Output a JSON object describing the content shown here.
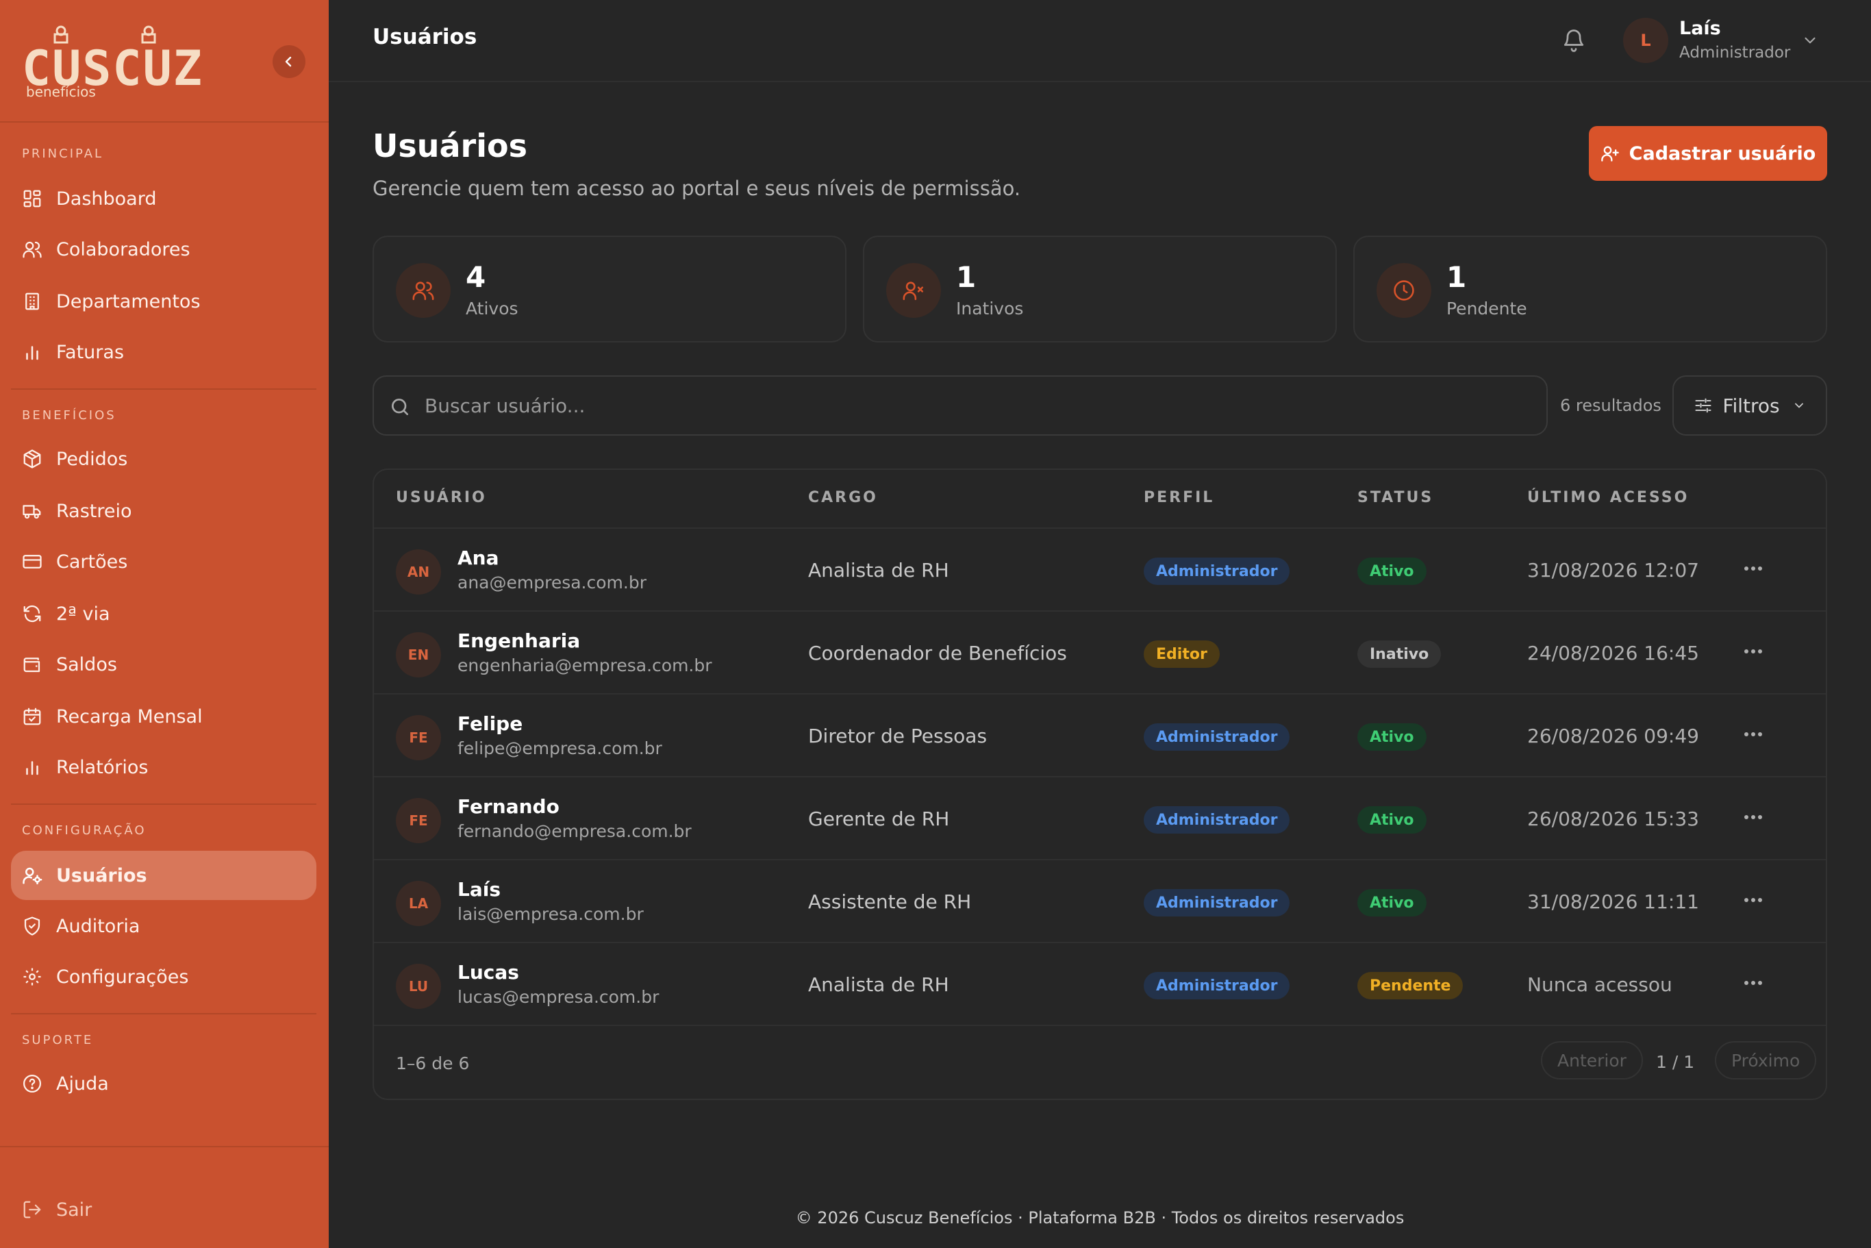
{
  "brand": {
    "name": "CUSCUZ",
    "sub": "benefícios",
    "color": "#c9512f",
    "accent": "#d9532a"
  },
  "sidebar": {
    "sections": [
      {
        "title": "PRINCIPAL"
      },
      {
        "title": "BENEFÍCIOS"
      },
      {
        "title": "CONFIGURAÇÃO"
      },
      {
        "title": "SUPORTE"
      }
    ],
    "items": [
      {
        "label": "Dashboard",
        "icon": "dashboard-icon"
      },
      {
        "label": "Colaboradores",
        "icon": "users-icon"
      },
      {
        "label": "Departamentos",
        "icon": "building-icon"
      },
      {
        "label": "Faturas",
        "icon": "bar-chart-icon"
      },
      {
        "label": "Pedidos",
        "icon": "package-icon"
      },
      {
        "label": "Rastreio",
        "icon": "truck-icon"
      },
      {
        "label": "Cartões",
        "icon": "credit-card-icon"
      },
      {
        "label": "2ª via",
        "icon": "refresh-icon"
      },
      {
        "label": "Saldos",
        "icon": "wallet-icon"
      },
      {
        "label": "Recarga Mensal",
        "icon": "calendar-icon"
      },
      {
        "label": "Relatórios",
        "icon": "bar-chart-icon"
      },
      {
        "label": "Usuários",
        "icon": "user-cog-icon",
        "active": true
      },
      {
        "label": "Auditoria",
        "icon": "shield-check-icon"
      },
      {
        "label": "Configurações",
        "icon": "gear-icon"
      },
      {
        "label": "Ajuda",
        "icon": "help-circle-icon"
      }
    ],
    "logout": {
      "label": "Sair",
      "icon": "logout-icon"
    }
  },
  "header": {
    "title": "Usuários",
    "user": {
      "initial": "L",
      "name": "Laís",
      "role": "Administrador"
    }
  },
  "main": {
    "title": "Usuários",
    "subtitle": "Gerencie quem tem acesso ao portal e seus níveis de permissão.",
    "primary_button": "Cadastrar usuário",
    "stats": [
      {
        "value": "4",
        "label": "Ativos",
        "icon": "users-icon"
      },
      {
        "value": "1",
        "label": "Inativos",
        "icon": "user-x-icon"
      },
      {
        "value": "1",
        "label": "Pendente",
        "icon": "clock-icon"
      }
    ],
    "search": {
      "placeholder": "Buscar usuário...",
      "value": ""
    },
    "results": "6 resultados",
    "filter_label": "Filtros"
  },
  "table": {
    "columns": [
      "USUÁRIO",
      "CARGO",
      "PERFIL",
      "STATUS",
      "ÚLTIMO ACESSO"
    ],
    "rows": [
      {
        "initials": "AN",
        "name": "Ana",
        "email": "ana@empresa.com.br",
        "cargo": "Analista de RH",
        "perfil": "Administrador",
        "status": "Ativo",
        "acesso": "31/08/2026 12:07"
      },
      {
        "initials": "EN",
        "name": "Engenharia",
        "email": "engenharia@empresa.com.br",
        "cargo": "Coordenador de Benefícios",
        "perfil": "Editor",
        "status": "Inativo",
        "acesso": "24/08/2026 16:45"
      },
      {
        "initials": "FE",
        "name": "Felipe",
        "email": "felipe@empresa.com.br",
        "cargo": "Diretor de Pessoas",
        "perfil": "Administrador",
        "status": "Ativo",
        "acesso": "26/08/2026 09:49"
      },
      {
        "initials": "FE",
        "name": "Fernando",
        "email": "fernando@empresa.com.br",
        "cargo": "Gerente de RH",
        "perfil": "Administrador",
        "status": "Ativo",
        "acesso": "26/08/2026 15:33"
      },
      {
        "initials": "LA",
        "name": "Laís",
        "email": "lais@empresa.com.br",
        "cargo": "Assistente de RH",
        "perfil": "Administrador",
        "status": "Ativo",
        "acesso": "31/08/2026 11:11"
      },
      {
        "initials": "LU",
        "name": "Lucas",
        "email": "lucas@empresa.com.br",
        "cargo": "Analista de RH",
        "perfil": "Administrador",
        "status": "Pendente",
        "acesso": "Nunca acessou"
      }
    ],
    "footer": {
      "range": "1–6 de 6",
      "prev": "Anterior",
      "page": "1 / 1",
      "next": "Próximo"
    }
  },
  "footer": {
    "text": "© 2026 Cuscuz Benefícios · Plataforma B2B · Todos os direitos reservados"
  }
}
